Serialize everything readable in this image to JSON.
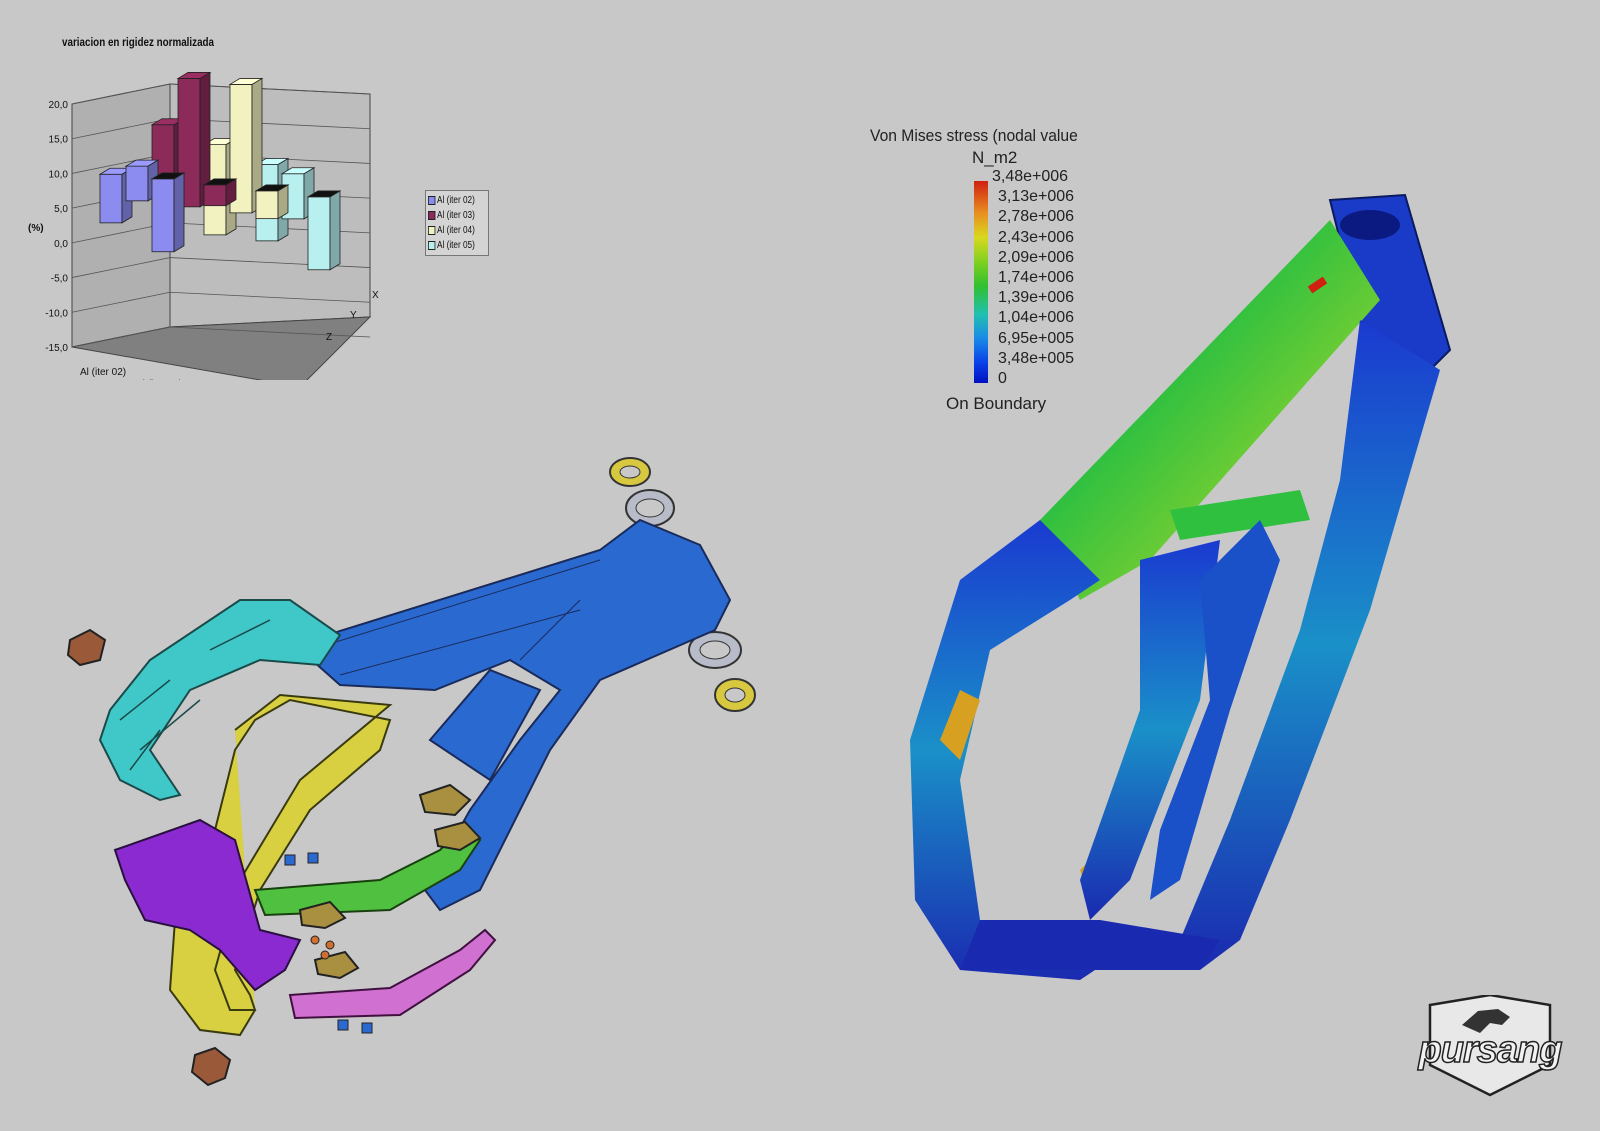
{
  "chart_data": {
    "type": "bar",
    "title": "variacion en rigidez normalizada",
    "ylabel": "(%)",
    "ylim": [
      -15,
      20
    ],
    "yticks": [
      "20,0",
      "15,0",
      "10,0",
      "5,0",
      "0,0",
      "-5,0",
      "-10,0",
      "-15,0"
    ],
    "categories": [
      "Al (iter 02)",
      "Al (iter 03)",
      "Al (iter 04)",
      "Al (iter 05)"
    ],
    "depth_labels": [
      "X",
      "Y",
      "Z"
    ],
    "series": [
      {
        "name": "Al (iter 02)",
        "color": "#8c8cf0",
        "values": [
          -10.5,
          5,
          7
        ]
      },
      {
        "name": "Al (iter 03)",
        "color": "#8c2a5a",
        "values": [
          -3,
          18.5,
          15
        ]
      },
      {
        "name": "Al (iter 04)",
        "color": "#f2f2c0",
        "values": [
          -4,
          18.5,
          13
        ]
      },
      {
        "name": "Al (iter 05)",
        "color": "#b8f0f0",
        "values": [
          -10.5,
          6.5,
          11
        ]
      }
    ],
    "grid": true,
    "legend": "right"
  },
  "stress_legend": {
    "title": "Von Mises stress (nodal value",
    "units": "N_m2",
    "values": [
      "3,48e+006",
      "3,13e+006",
      "2,78e+006",
      "2,43e+006",
      "2,09e+006",
      "1,74e+006",
      "1,39e+006",
      "1,04e+006",
      "6,95e+005",
      "3,48e+005",
      "0"
    ],
    "footer": "On Boundary"
  },
  "logo": {
    "text": "pursang"
  }
}
